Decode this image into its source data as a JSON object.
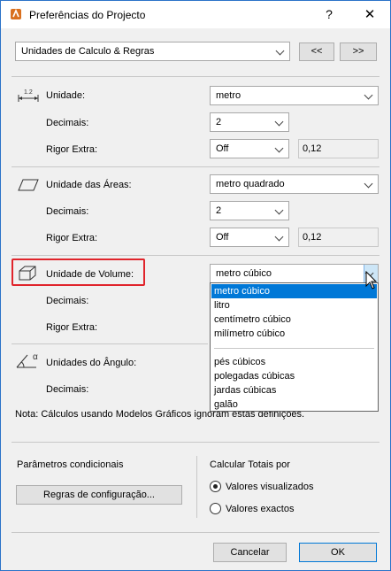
{
  "window": {
    "title": "Preferências do Projecto",
    "help_label": "?",
    "close_label": "✕"
  },
  "header": {
    "page_select": "Unidades de Calculo & Regras",
    "prev_label": "<<",
    "next_label": ">>"
  },
  "length": {
    "unit_label": "Unidade:",
    "unit_value": "metro",
    "decimals_label": "Decimais:",
    "decimals_value": "2",
    "rigor_label": "Rigor Extra:",
    "rigor_value": "Off",
    "rigor_number": "0,12",
    "icon_number": "1.2"
  },
  "area": {
    "unit_label": "Unidade das Áreas:",
    "unit_value": "metro quadrado",
    "decimals_label": "Decimais:",
    "decimals_value": "2",
    "rigor_label": "Rigor Extra:",
    "rigor_value": "Off",
    "rigor_number": "0,12"
  },
  "volume": {
    "unit_label": "Unidade de Volume:",
    "unit_value": "metro cúbico",
    "decimals_label": "Decimais:",
    "rigor_label": "Rigor Extra:"
  },
  "volume_options": {
    "group1": [
      "metro cúbico",
      "litro",
      "centímetro cúbico",
      "milímetro cúbico"
    ],
    "group2": [
      "pés cúbicos",
      "polegadas cúbicas",
      "jardas cúbicas",
      "galão"
    ],
    "selected": "metro cúbico"
  },
  "angle": {
    "unit_label": "Unidades do Ângulo:",
    "decimals_label": "Decimais:",
    "icon_symbol": "α"
  },
  "note": "Nota: Cálculos usando Modelos Gráficos ignoram estas definições.",
  "conditional": {
    "label": "Parâmetros condicionais",
    "button": "Regras de configuração..."
  },
  "totals": {
    "label": "Calcular Totais por",
    "option1": "Valores visualizados",
    "option2": "Valores exactos",
    "selected": "Valores visualizados"
  },
  "footer": {
    "cancel": "Cancelar",
    "ok": "OK"
  },
  "colors": {
    "accent": "#0078d7",
    "highlight": "#e0242b"
  }
}
